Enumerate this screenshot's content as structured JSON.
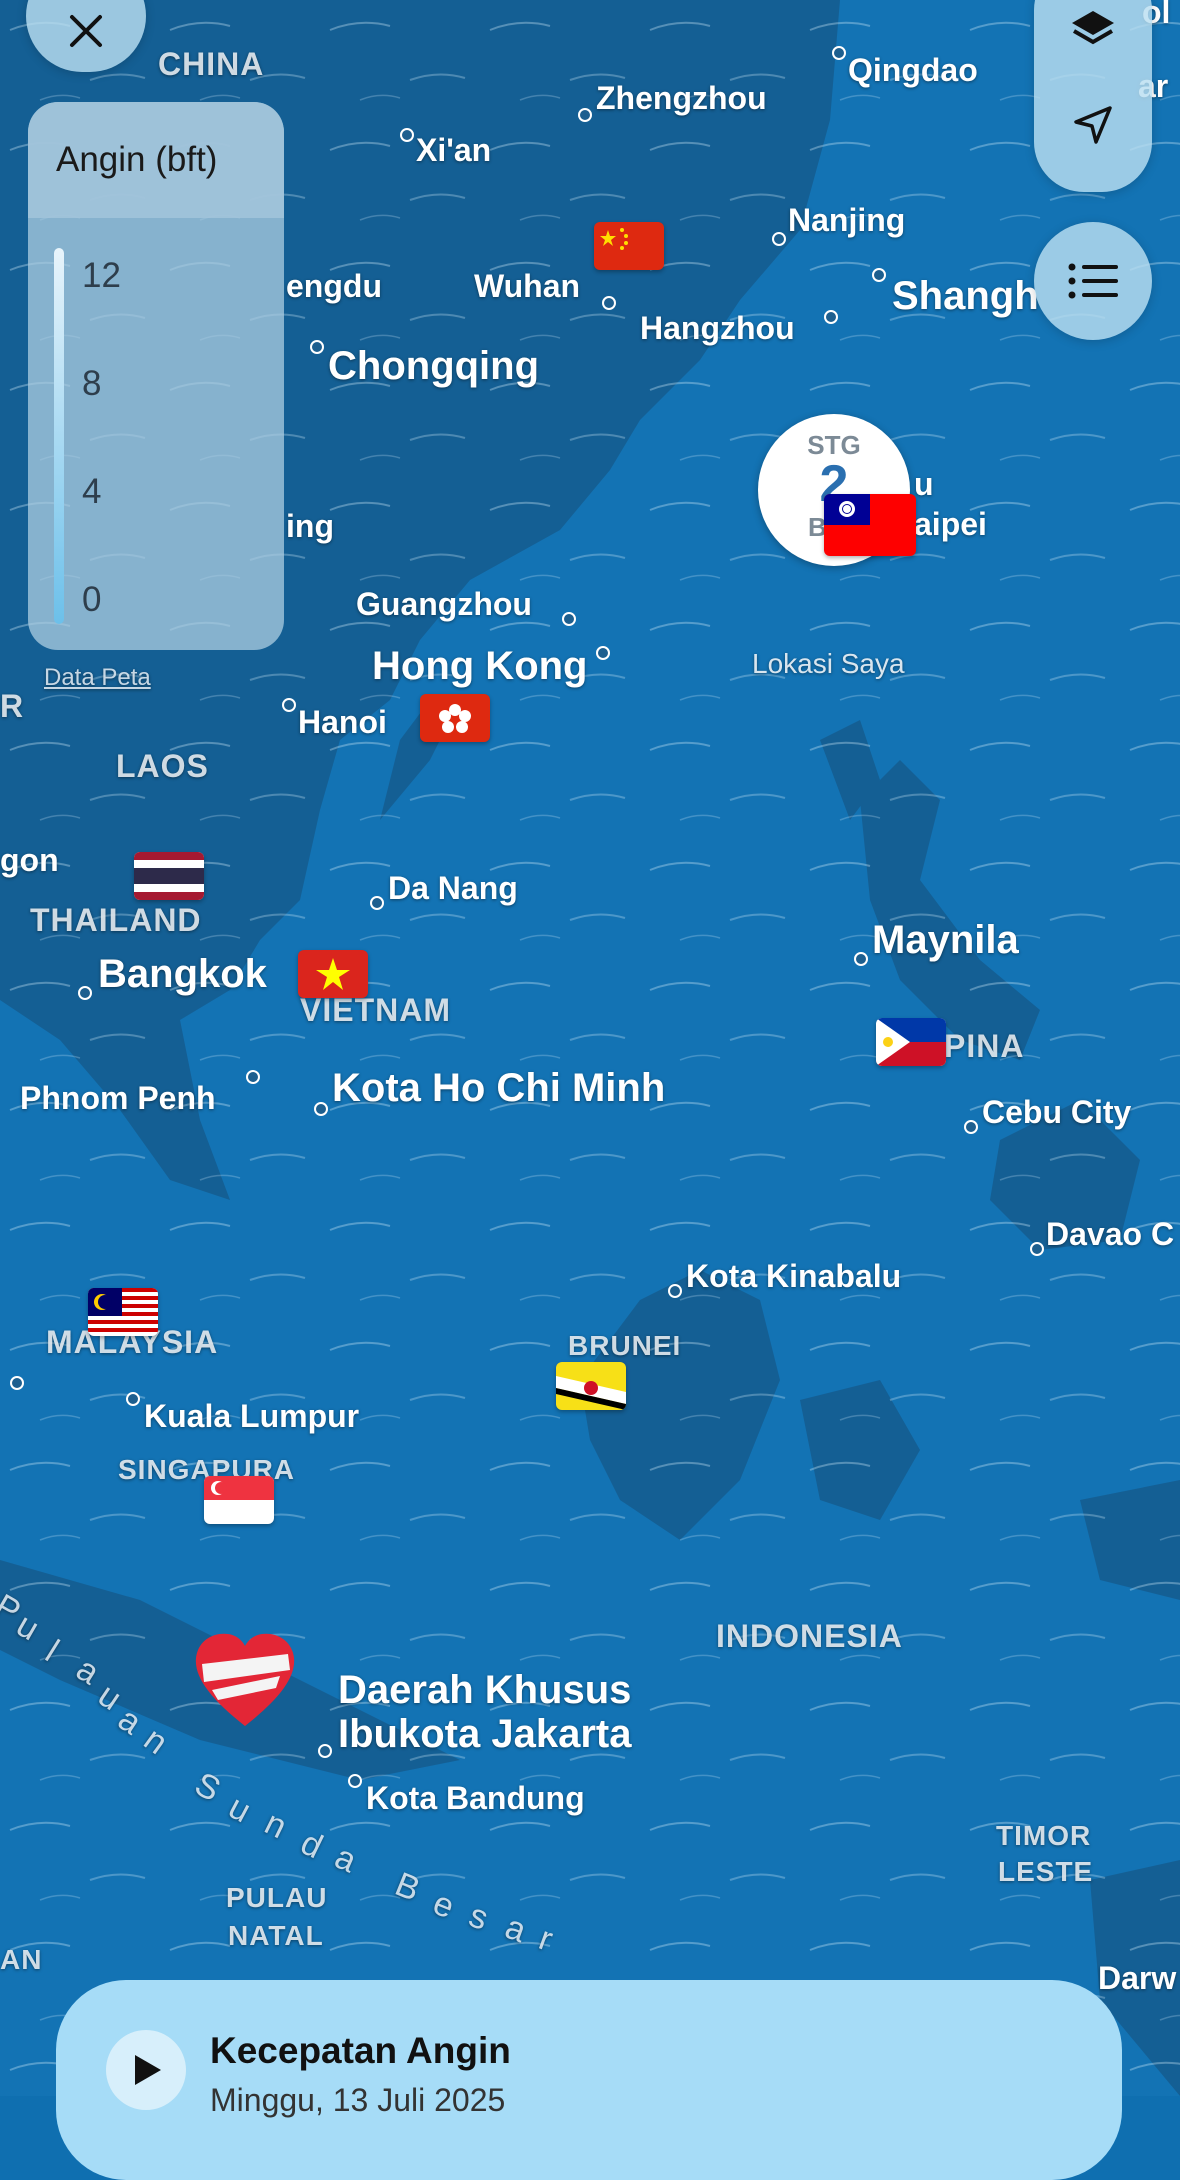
{
  "colors": {
    "sea": "#1373b4",
    "land": "#155f95",
    "panel": "#bde3f5"
  },
  "legend": {
    "title": "Angin (bft)",
    "ticks": [
      "12",
      "8",
      "4",
      "0"
    ]
  },
  "map_credit": "Data Peta",
  "location_label": "Lokasi Saya",
  "badge": {
    "line1": "STG",
    "line2": "2",
    "line3": "B"
  },
  "cities": {
    "qingdao": "Qingdao",
    "zhengzhou": "Zhengzhou",
    "xian": "Xi'an",
    "nanjing": "Nanjing",
    "chengdu": "engdu",
    "wuhan": "Wuhan",
    "hangzhou": "Hangzhou",
    "shanghai": "Shangh",
    "chongqing": "Chongqing",
    "taipei_top": "u",
    "taipei": "aipei",
    "nanning": "ing",
    "guangzhou": "Guangzhou",
    "hongkong": "Hong Kong",
    "hanoi": "Hanoi",
    "yangon": "gon",
    "danang": "Da Nang",
    "maynila": "Maynila",
    "bangkok": "Bangkok",
    "phnompenh": "Phnom Penh",
    "hcm": "Kota Ho Chi Minh",
    "cebu": "Cebu City",
    "davao": "Davao C",
    "kinabalu": "Kota Kinabalu",
    "kl": "Kuala Lumpur",
    "jakarta1": "Daerah Khusus",
    "jakarta2": "Ibukota Jakarta",
    "bandung": "Kota Bandung",
    "darwin": "Darw",
    "edge_ar": "ar",
    "edge_ol": "ol"
  },
  "countries": {
    "china": "CHINA",
    "laos": "LAOS",
    "thailand": "THAILAND",
    "vietnam": "VIETNAM",
    "pilipina": "PINA",
    "malaysia": "MALAYSIA",
    "brunei": "BRUNEI",
    "singapura": "SINGAPURA",
    "indonesia": "INDONESIA",
    "timor1": "TIMOR",
    "timor2": "LESTE",
    "natal1": "PULAU",
    "natal2": "NATAL",
    "edge_r": "R",
    "edge_an": "AN"
  },
  "sunda_letters": [
    "P",
    "u",
    "l",
    "a",
    "u",
    "a",
    "n",
    "S",
    "u",
    "n",
    "d",
    "a",
    "B",
    "e",
    "s",
    "a",
    "r"
  ],
  "flags": [
    "china-flag",
    "taiwan-flag",
    "hongkong-flag",
    "thailand-flag",
    "vietnam-flag",
    "philippines-flag",
    "malaysia-flag",
    "brunei-flag",
    "singapore-flag",
    "heart-icon"
  ],
  "panel": {
    "title": "Kecepatan Angin",
    "subtitle": "Minggu, 13 Juli 2025"
  },
  "icons": {
    "close": "close-icon",
    "layers": "layers-icon",
    "location": "location-arrow-icon",
    "list": "list-icon",
    "play": "play-icon"
  }
}
